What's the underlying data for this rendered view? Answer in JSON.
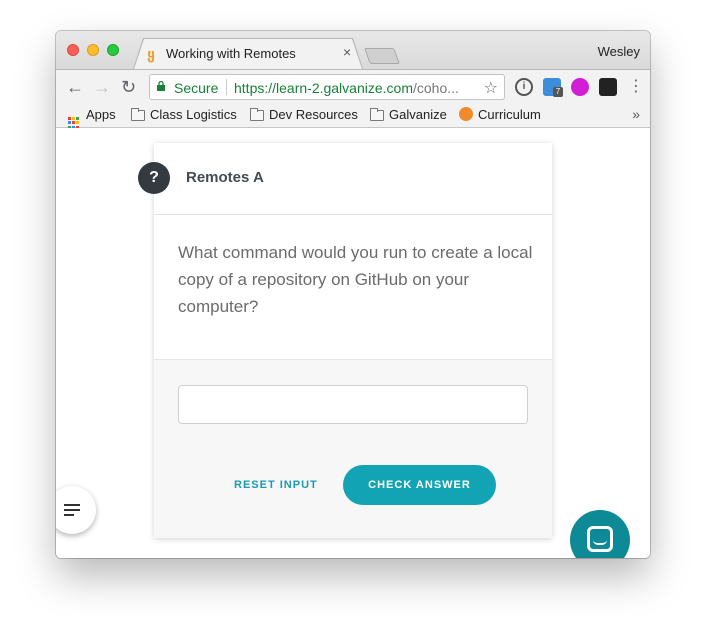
{
  "browser": {
    "tab_title": "Working with Remotes",
    "tab_close": "×",
    "profile_name": "Wesley",
    "secure_label": "Secure",
    "url_domain": "https://learn-2.galvanize.com",
    "url_rest": "/coho...",
    "extension_badge": "7",
    "extension_1_glyph": "i"
  },
  "bookmarks": {
    "items": [
      "Apps",
      "Class Logistics",
      "Dev Resources",
      "Galvanize",
      "Curriculum"
    ],
    "more": "»"
  },
  "card": {
    "badge": "?",
    "title": "Remotes A",
    "question": "What command would you run to create a local copy of a repository on GitHub on your computer?",
    "answer_value": "",
    "reset_label": "RESET INPUT",
    "check_label": "CHECK ANSWER"
  },
  "colors": {
    "accent": "#12a4b4",
    "chat": "#0d8a95",
    "badge": "#333a40",
    "secure": "#188038"
  }
}
